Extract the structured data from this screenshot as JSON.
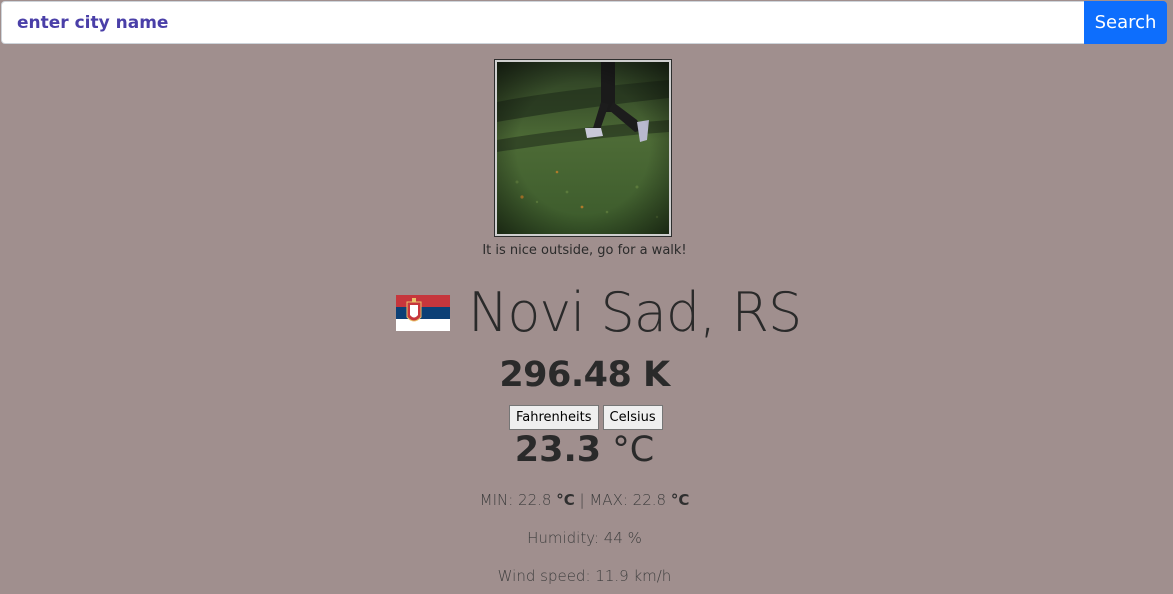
{
  "search": {
    "placeholder": "enter city name",
    "button_label": "Search"
  },
  "image": {
    "caption": "It is nice outside, go for a walk!"
  },
  "location": {
    "city": "Novi Sad, RS"
  },
  "temperature": {
    "kelvin": "296.48 K",
    "fahrenheit_label": "Fahrenheits",
    "celsius_label": "Celsius",
    "converted_value": "23.3",
    "converted_unit": "°C"
  },
  "details": {
    "min_label": "MIN: 22.8",
    "min_unit": "°C",
    "separator": "|",
    "max_label": "MAX: 22.8",
    "max_unit": "°C",
    "humidity": "Humidity: 44 %",
    "wind": "Wind speed: 11.9 km/h"
  },
  "colors": {
    "background": "#a08f8e",
    "accent": "#0d6efd",
    "input_text": "#4a3fa8"
  }
}
